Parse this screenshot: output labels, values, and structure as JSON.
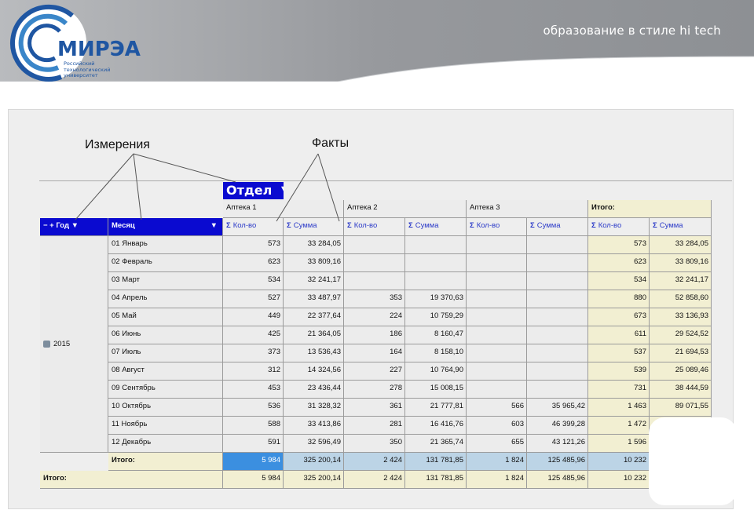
{
  "header": {
    "tagline": "образование в стиле hi tech",
    "logo_word": "МИРЭА",
    "logo_sub": [
      "Российский",
      "технологический",
      "университет"
    ]
  },
  "callouts": {
    "dimensions": "Измерения",
    "facts": "Факты"
  },
  "pivot": {
    "col_dim_button": "Отдел",
    "row_dim_buttons": [
      "Год",
      "Месяц"
    ],
    "pharmacies": [
      "Аптека 1",
      "Аптека 2",
      "Аптека 3"
    ],
    "total_header": "Итого:",
    "measures": [
      "Кол-во",
      "Сумма"
    ],
    "year": "2015",
    "months": [
      "01 Январь",
      "02 Февраль",
      "03 Март",
      "04 Апрель",
      "05 Май",
      "06 Июнь",
      "07 Июль",
      "08 Август",
      "09 Сентябрь",
      "10 Октябрь",
      "11 Ноябрь",
      "12 Декабрь"
    ],
    "rows": [
      {
        "a1q": "573",
        "a1s": "33 284,05",
        "a2q": "",
        "a2s": "",
        "a3q": "",
        "a3s": "",
        "tq": "573",
        "ts": "33 284,05"
      },
      {
        "a1q": "623",
        "a1s": "33 809,16",
        "a2q": "",
        "a2s": "",
        "a3q": "",
        "a3s": "",
        "tq": "623",
        "ts": "33 809,16"
      },
      {
        "a1q": "534",
        "a1s": "32 241,17",
        "a2q": "",
        "a2s": "",
        "a3q": "",
        "a3s": "",
        "tq": "534",
        "ts": "32 241,17"
      },
      {
        "a1q": "527",
        "a1s": "33 487,97",
        "a2q": "353",
        "a2s": "19 370,63",
        "a3q": "",
        "a3s": "",
        "tq": "880",
        "ts": "52 858,60"
      },
      {
        "a1q": "449",
        "a1s": "22 377,64",
        "a2q": "224",
        "a2s": "10 759,29",
        "a3q": "",
        "a3s": "",
        "tq": "673",
        "ts": "33 136,93"
      },
      {
        "a1q": "425",
        "a1s": "21 364,05",
        "a2q": "186",
        "a2s": "8 160,47",
        "a3q": "",
        "a3s": "",
        "tq": "611",
        "ts": "29 524,52"
      },
      {
        "a1q": "373",
        "a1s": "13 536,43",
        "a2q": "164",
        "a2s": "8 158,10",
        "a3q": "",
        "a3s": "",
        "tq": "537",
        "ts": "21 694,53"
      },
      {
        "a1q": "312",
        "a1s": "14 324,56",
        "a2q": "227",
        "a2s": "10 764,90",
        "a3q": "",
        "a3s": "",
        "tq": "539",
        "ts": "25 089,46"
      },
      {
        "a1q": "453",
        "a1s": "23 436,44",
        "a2q": "278",
        "a2s": "15 008,15",
        "a3q": "",
        "a3s": "",
        "tq": "731",
        "ts": "38 444,59"
      },
      {
        "a1q": "536",
        "a1s": "31 328,32",
        "a2q": "361",
        "a2s": "21 777,81",
        "a3q": "566",
        "a3s": "35 965,42",
        "tq": "1 463",
        "ts": "89 071,55"
      },
      {
        "a1q": "588",
        "a1s": "33 413,86",
        "a2q": "281",
        "a2s": "16 416,76",
        "a3q": "603",
        "a3s": "46 399,28",
        "tq": "1 472",
        "ts": ""
      },
      {
        "a1q": "591",
        "a1s": "32 596,49",
        "a2q": "350",
        "a2s": "21 365,74",
        "a3q": "655",
        "a3s": "43 121,26",
        "tq": "1 596",
        "ts": ""
      }
    ],
    "subtotal": {
      "label": "Итого:",
      "a1q": "5 984",
      "a1s": "325 200,14",
      "a2q": "2 424",
      "a2s": "131 781,85",
      "a3q": "1 824",
      "a3s": "125 485,96",
      "tq": "10 232",
      "ts": ""
    },
    "grand": {
      "label": "Итого:",
      "a1q": "5 984",
      "a1s": "325 200,14",
      "a2q": "2 424",
      "a2s": "131 781,85",
      "a3q": "1 824",
      "a3s": "125 485,96",
      "tq": "10 232",
      "ts": ""
    }
  },
  "colors": {
    "accent_blue": "#0a0ad0",
    "header_band": "#8f9296",
    "total_yellow": "#f2efd2",
    "subtotal_blue": "#bcd4e6"
  }
}
